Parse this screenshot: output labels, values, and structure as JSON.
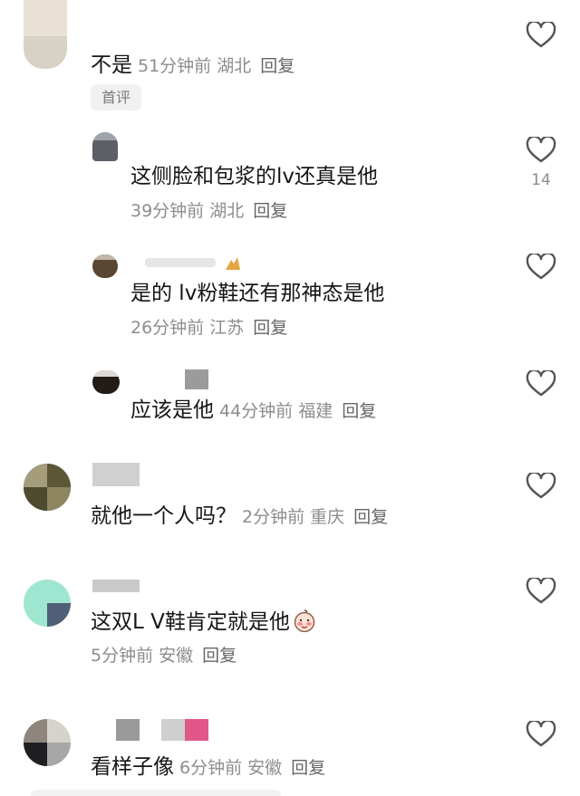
{
  "comments": [
    {
      "text": "不是",
      "time": "51分钟前",
      "location": "湖北",
      "reply": "回复",
      "badge": "首评"
    },
    {
      "text": "这侧脸和包浆的lv还真是他",
      "time": "39分钟前",
      "location": "湖北",
      "reply": "回复",
      "likes": "14"
    },
    {
      "text": "是的 lv粉鞋还有那神态是他",
      "time": "26分钟前",
      "location": "江苏",
      "reply": "回复"
    },
    {
      "text": "应该是他",
      "time": "44分钟前",
      "location": "福建",
      "reply": "回复"
    },
    {
      "text": "就他一个人吗？",
      "time": "2分钟前",
      "location": "重庆",
      "reply": "回复"
    },
    {
      "text": "这双L V鞋肯定就是他",
      "time": "5分钟前",
      "location": "安徽",
      "reply": "回复"
    },
    {
      "text": "看样子像",
      "time": "6分钟前",
      "location": "安徽",
      "reply": "回复"
    }
  ],
  "icons": {
    "like": "heart-outline-icon",
    "emoji": "blushing-face-emoji"
  },
  "colors": {
    "text": "#161616",
    "meta": "#8d8d8d",
    "badge_bg": "#f1f1f1"
  }
}
